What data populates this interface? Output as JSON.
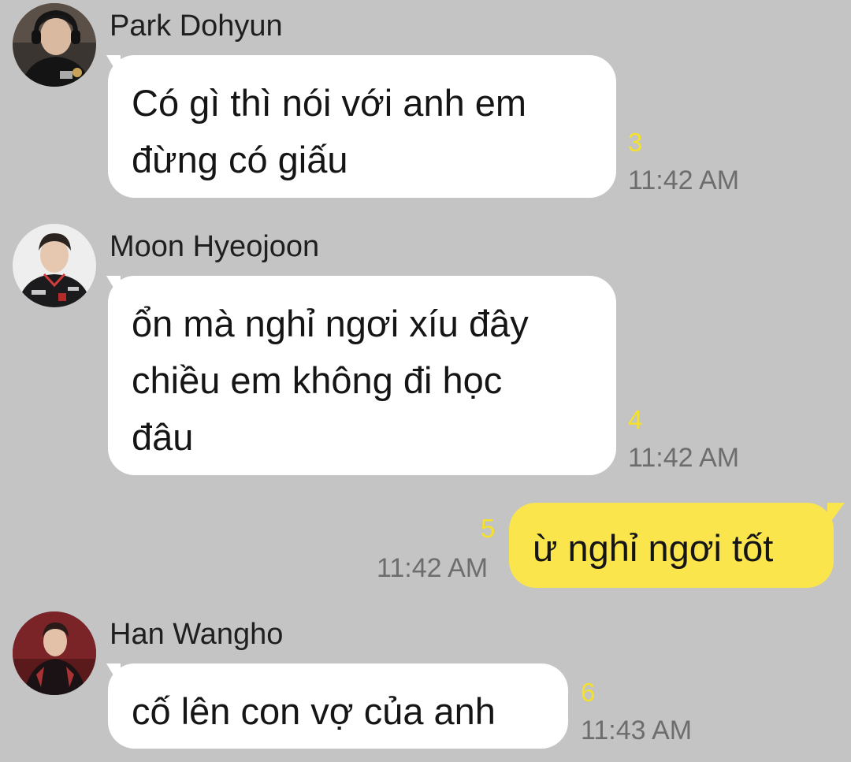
{
  "messages": [
    {
      "sender": "Park Dohyun",
      "lines": [
        "Có gì thì nói với anh em",
        "đừng có giấu"
      ],
      "unread": "3",
      "time": "11:42 AM",
      "direction": "incoming"
    },
    {
      "sender": "Moon Hyeojoon",
      "lines": [
        "ổn mà nghỉ ngơi xíu đây",
        "chiều em không đi học",
        "đâu"
      ],
      "unread": "4",
      "time": "11:42 AM",
      "direction": "incoming"
    },
    {
      "lines": [
        "ừ nghỉ ngơi tốt"
      ],
      "unread": "5",
      "time": "11:42 AM",
      "direction": "outgoing"
    },
    {
      "sender": "Han Wangho",
      "lines": [
        "cố lên con vợ của anh"
      ],
      "unread": "6",
      "time": "11:43 AM",
      "direction": "incoming"
    }
  ],
  "colors": {
    "background": "#c4c4c4",
    "incoming_bubble": "#ffffff",
    "outgoing_bubble": "#fbe54d",
    "unread_count": "#f5e02c",
    "timestamp": "#6d6d6d"
  },
  "icons": {
    "avatar": "profile-photo"
  }
}
